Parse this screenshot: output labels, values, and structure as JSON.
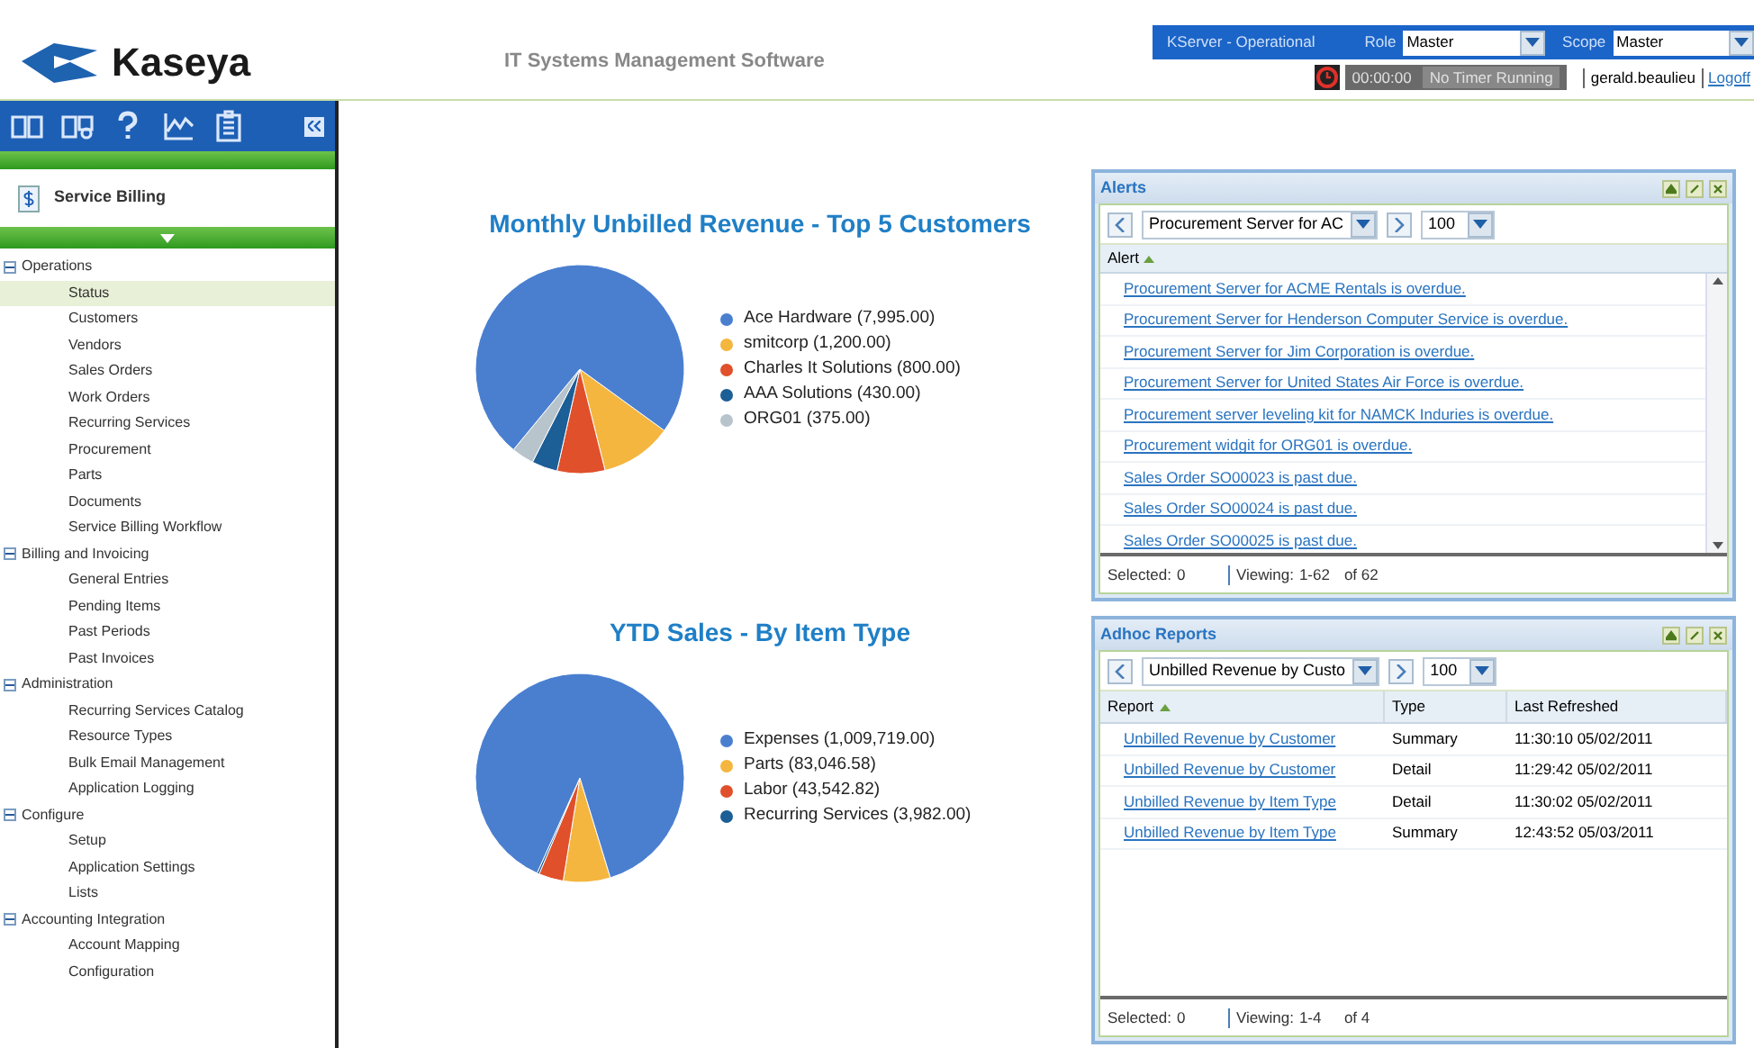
{
  "header": {
    "logo": "Kaseya",
    "subtitle": "IT Systems Management Software",
    "server_status": "KServer - Operational",
    "role": {
      "label": "Role",
      "value": "Master"
    },
    "scope": {
      "label": "Scope",
      "value": "Master"
    },
    "timer": {
      "time": "00:00:00",
      "status": "No Timer Running"
    },
    "user": "gerald.beaulieu",
    "logoff": "Logoff"
  },
  "sidebar": {
    "module": "Service Billing",
    "tree": [
      {
        "label": "Operations",
        "expanded": true,
        "children": [
          {
            "label": "Status",
            "selected": true
          },
          {
            "label": "Customers",
            "selected": false
          },
          {
            "label": "Vendors",
            "selected": false
          },
          {
            "label": "Sales Orders",
            "selected": false
          },
          {
            "label": "Work Orders",
            "selected": false
          },
          {
            "label": "Recurring Services",
            "selected": false
          },
          {
            "label": "Procurement",
            "selected": false
          },
          {
            "label": "Parts",
            "selected": false
          },
          {
            "label": "Documents",
            "selected": false
          },
          {
            "label": "Service Billing Workflow",
            "selected": false
          }
        ]
      },
      {
        "label": "Billing and Invoicing",
        "expanded": true,
        "children": [
          {
            "label": "General Entries",
            "selected": false
          },
          {
            "label": "Pending Items",
            "selected": false
          },
          {
            "label": "Past Periods",
            "selected": false
          },
          {
            "label": "Past Invoices",
            "selected": false
          }
        ]
      },
      {
        "label": "Administration",
        "expanded": true,
        "children": [
          {
            "label": "Recurring Services Catalog",
            "selected": false
          },
          {
            "label": "Resource Types",
            "selected": false
          },
          {
            "label": "Bulk Email Management",
            "selected": false
          },
          {
            "label": "Application Logging",
            "selected": false
          }
        ]
      },
      {
        "label": "Configure",
        "expanded": true,
        "children": [
          {
            "label": "Setup",
            "selected": false
          },
          {
            "label": "Application Settings",
            "selected": false
          },
          {
            "label": "Lists",
            "selected": false
          }
        ]
      },
      {
        "label": "Accounting Integration",
        "expanded": true,
        "children": [
          {
            "label": "Account Mapping",
            "selected": false
          },
          {
            "label": "Configuration",
            "selected": false
          }
        ]
      }
    ]
  },
  "charts": [
    {
      "chart_data": {
        "type": "pie",
        "title": "Monthly Unbilled Revenue - Top 5 Customers",
        "categories": [
          "Ace Hardware (7,995.00)",
          "smitcorp (1,200.00)",
          "Charles It Solutions (800.00)",
          "AAA Solutions (430.00)",
          "ORG01 (375.00)"
        ],
        "values": [
          7995,
          1200,
          800,
          430,
          375
        ],
        "legend": "right",
        "colors": [
          "#4a7fd0",
          "#f4b63f",
          "#e0502a",
          "#1c5e96",
          "#b8c4cc"
        ]
      }
    },
    {
      "chart_data": {
        "type": "pie",
        "title": "YTD Sales - By Item Type",
        "categories": [
          "Expenses (1,009,719.00)",
          "Parts (83,046.58)",
          "Labor (43,542.82)",
          "Recurring Services (3,982.00)"
        ],
        "values": [
          1009719,
          83046.58,
          43542.82,
          3982
        ],
        "legend": "right",
        "colors": [
          "#4a7fd0",
          "#f4b63f",
          "#e0502a",
          "#1c5e96"
        ]
      }
    }
  ],
  "alerts": {
    "title": "Alerts",
    "filter": "Procurement Server for AC",
    "page_size": "100",
    "columns": [
      "Alert"
    ],
    "rows": [
      "Procurement Server for ACME Rentals is overdue.",
      "Procurement Server for Henderson Computer Service is overdue.",
      "Procurement Server for Jim Corporation is overdue.",
      "Procurement Server for United States Air Force is overdue.",
      "Procurement server leveling kit for NAMCK Induries is overdue.",
      "Procurement widgit for ORG01 is overdue.",
      "Sales Order SO00023 is past due.",
      "Sales Order SO00024 is past due.",
      "Sales Order SO00025 is past due."
    ],
    "footer": {
      "selected_label": "Selected:",
      "selected": "0",
      "viewing_label": "Viewing:",
      "viewing": "1-62",
      "total": "of 62"
    }
  },
  "reports": {
    "title": "Adhoc Reports",
    "filter": "Unbilled Revenue by Custo",
    "page_size": "100",
    "columns": [
      "Report",
      "Type",
      "Last Refreshed"
    ],
    "rows": [
      [
        "Unbilled Revenue by Customer",
        "Summary",
        "11:30:10 05/02/2011"
      ],
      [
        "Unbilled Revenue by Customer",
        "Detail",
        "11:29:42 05/02/2011"
      ],
      [
        "Unbilled Revenue by Item Type",
        "Detail",
        "11:30:02 05/02/2011"
      ],
      [
        "Unbilled Revenue by Item Type",
        "Summary",
        "12:43:52 05/03/2011"
      ]
    ],
    "footer": {
      "selected_label": "Selected:",
      "selected": "0",
      "viewing_label": "Viewing:",
      "viewing": "1-4",
      "total": "of 4"
    }
  }
}
